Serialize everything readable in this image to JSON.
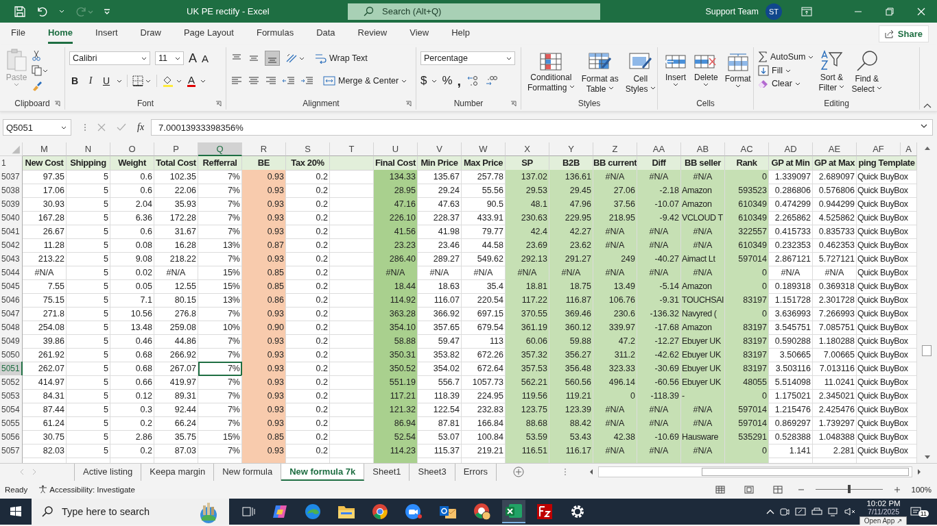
{
  "title_bar": {
    "title": "UK PE rectify  -  Excel",
    "search_placeholder": "Search (Alt+Q)",
    "user": "Support Team",
    "avatar": "ST"
  },
  "menu_tabs": [
    {
      "label": "File",
      "selected": false
    },
    {
      "label": "Home",
      "selected": true
    },
    {
      "label": "Insert",
      "selected": false
    },
    {
      "label": "Draw",
      "selected": false
    },
    {
      "label": "Page Layout",
      "selected": false
    },
    {
      "label": "Formulas",
      "selected": false
    },
    {
      "label": "Data",
      "selected": false
    },
    {
      "label": "Review",
      "selected": false
    },
    {
      "label": "View",
      "selected": false
    },
    {
      "label": "Help",
      "selected": false
    }
  ],
  "share": "Share",
  "ribbon": {
    "clipboard": {
      "paste": "Paste",
      "label": "Clipboard"
    },
    "font": {
      "name": "Calibri",
      "size": "11",
      "grow": "A",
      "shrink": "A",
      "bold": "B",
      "italic": "I",
      "underline": "U",
      "font_color": "A",
      "label": "Font"
    },
    "alignment": {
      "wrap": "Wrap Text",
      "merge": "Merge & Center",
      "label": "Alignment"
    },
    "number": {
      "format": "Percentage",
      "currency": "$",
      "percent": "%",
      "comma": ",",
      "label": "Number"
    },
    "styles": {
      "buttons": [
        [
          "Conditional",
          "Formatting"
        ],
        [
          "Format as",
          "Table"
        ],
        [
          "Cell",
          "Styles"
        ]
      ],
      "label": "Styles"
    },
    "cells": {
      "buttons": [
        "Insert",
        "Delete",
        "Format"
      ],
      "label": "Cells"
    },
    "editing": {
      "autosum": "AutoSum",
      "fill": "Fill",
      "clear": "Clear",
      "sort": [
        "Sort &",
        "Filter"
      ],
      "find": [
        "Find &",
        "Select"
      ],
      "label": "Editing"
    }
  },
  "formula_bar": {
    "name_box": "Q5051",
    "fx": "fx",
    "formula": "7.00013933398356%"
  },
  "sheet": {
    "header_row": "1",
    "columns": [
      {
        "letter": "M",
        "heading": "New Cost",
        "kind": "number",
        "selected": false
      },
      {
        "letter": "N",
        "heading": "Shipping",
        "kind": "number",
        "selected": false
      },
      {
        "letter": "O",
        "heading": "Weight",
        "kind": "number",
        "selected": false
      },
      {
        "letter": "P",
        "heading": "Total Cost",
        "kind": "number",
        "selected": false
      },
      {
        "letter": "Q",
        "heading": "Refferral",
        "kind": "number",
        "selected": true
      },
      {
        "letter": "R",
        "heading": "BE",
        "kind": "number",
        "selected": false,
        "color": "#f8cbad"
      },
      {
        "letter": "S",
        "heading": "Tax 20%",
        "kind": "number",
        "selected": false
      },
      {
        "letter": "T",
        "kind": "blank",
        "selected": false
      },
      {
        "letter": "U",
        "heading": "Final Cost",
        "kind": "number",
        "selected": false,
        "color": "#a9d08e"
      },
      {
        "letter": "V",
        "heading": "Min Price",
        "kind": "number",
        "selected": false
      },
      {
        "letter": "W",
        "heading": "Max Price",
        "kind": "number",
        "selected": false
      },
      {
        "letter": "X",
        "heading": "SP",
        "kind": "number",
        "selected": false,
        "color": "#c6e0b4"
      },
      {
        "letter": "Y",
        "heading": "B2B",
        "kind": "number",
        "selected": false,
        "color": "#c6e0b4"
      },
      {
        "letter": "Z",
        "heading": "BB current",
        "kind": "number",
        "selected": false,
        "color": "#c6e0b4"
      },
      {
        "letter": "AA",
        "heading": "Diff",
        "kind": "number",
        "selected": false,
        "color": "#c6e0b4"
      },
      {
        "letter": "AB",
        "heading": "BB seller",
        "kind": "text",
        "selected": false,
        "color": "#c6e0b4"
      },
      {
        "letter": "AC",
        "heading": "Rank",
        "kind": "number",
        "selected": false,
        "color": "#c6e0b4"
      },
      {
        "letter": "AD",
        "heading": "GP at Min",
        "kind": "number",
        "selected": false
      },
      {
        "letter": "AE",
        "heading": "GP at Max",
        "kind": "number",
        "selected": false
      },
      {
        "letter": "AF",
        "heading": "ping Template",
        "kind": "text",
        "selected": false
      },
      {
        "letter": "A",
        "kind": "cut",
        "selected": false
      }
    ],
    "rows": [
      {
        "number": "5037",
        "selected": false,
        "cells": [
          "97.35",
          "5",
          "0.6",
          "102.35",
          "7%",
          "0.93",
          "0.2",
          "",
          "134.33",
          "135.67",
          "257.78",
          "137.02",
          "136.61",
          "#N/A",
          "#N/A",
          "#N/A",
          "0",
          "1.339097",
          "2.689097",
          "Quick BuyBox"
        ]
      },
      {
        "number": "5038",
        "selected": false,
        "cells": [
          "17.06",
          "5",
          "0.6",
          "22.06",
          "7%",
          "0.93",
          "0.2",
          "",
          "28.95",
          "29.24",
          "55.56",
          "29.53",
          "29.45",
          "27.06",
          "-2.18",
          "Amazon",
          "593523",
          "0.286806",
          "0.576806",
          "Quick BuyBox"
        ]
      },
      {
        "number": "5039",
        "selected": false,
        "cells": [
          "30.93",
          "5",
          "2.04",
          "35.93",
          "7%",
          "0.93",
          "0.2",
          "",
          "47.16",
          "47.63",
          "90.5",
          "48.1",
          "47.96",
          "37.56",
          "-10.07",
          "Amazon",
          "610349",
          "0.474299",
          "0.944299",
          "Quick BuyBox"
        ]
      },
      {
        "number": "5040",
        "selected": false,
        "cells": [
          "167.28",
          "5",
          "6.36",
          "172.28",
          "7%",
          "0.93",
          "0.2",
          "",
          "226.10",
          "228.37",
          "433.91",
          "230.63",
          "229.95",
          "218.95",
          "-9.42",
          "VCLOUD T",
          "610349",
          "2.265862",
          "4.525862",
          "Quick BuyBox"
        ]
      },
      {
        "number": "5041",
        "selected": false,
        "cells": [
          "26.67",
          "5",
          "0.6",
          "31.67",
          "7%",
          "0.93",
          "0.2",
          "",
          "41.56",
          "41.98",
          "79.77",
          "42.4",
          "42.27",
          "#N/A",
          "#N/A",
          "#N/A",
          "322557",
          "0.415733",
          "0.835733",
          "Quick BuyBox"
        ]
      },
      {
        "number": "5042",
        "selected": false,
        "cells": [
          "11.28",
          "5",
          "0.08",
          "16.28",
          "13%",
          "0.87",
          "0.2",
          "",
          "23.23",
          "23.46",
          "44.58",
          "23.69",
          "23.62",
          "#N/A",
          "#N/A",
          "#N/A",
          "610349",
          "0.232353",
          "0.462353",
          "Quick BuyBox"
        ]
      },
      {
        "number": "5043",
        "selected": false,
        "cells": [
          "213.22",
          "5",
          "9.08",
          "218.22",
          "7%",
          "0.93",
          "0.2",
          "",
          "286.40",
          "289.27",
          "549.62",
          "292.13",
          "291.27",
          "249",
          "-40.27",
          "Aimact Lt",
          "597014",
          "2.867121",
          "5.727121",
          "Quick BuyBox"
        ]
      },
      {
        "number": "5044",
        "selected": false,
        "cells": [
          "#N/A",
          "5",
          "0.02",
          "#N/A",
          "15%",
          "0.85",
          "0.2",
          "",
          "#N/A",
          "#N/A",
          "#N/A",
          "#N/A",
          "#N/A",
          "#N/A",
          "#N/A",
          "#N/A",
          "0",
          "#N/A",
          "#N/A",
          "Quick BuyBox"
        ]
      },
      {
        "number": "5045",
        "selected": false,
        "cells": [
          "7.55",
          "5",
          "0.05",
          "12.55",
          "15%",
          "0.85",
          "0.2",
          "",
          "18.44",
          "18.63",
          "35.4",
          "18.81",
          "18.75",
          "13.49",
          "-5.14",
          "Amazon",
          "0",
          "0.189318",
          "0.369318",
          "Quick BuyBox"
        ]
      },
      {
        "number": "5046",
        "selected": false,
        "cells": [
          "75.15",
          "5",
          "7.1",
          "80.15",
          "13%",
          "0.86",
          "0.2",
          "",
          "114.92",
          "116.07",
          "220.54",
          "117.22",
          "116.87",
          "106.76",
          "-9.31",
          "TOUCHSAI",
          "83197",
          "1.151728",
          "2.301728",
          "Quick BuyBox"
        ]
      },
      {
        "number": "5047",
        "selected": false,
        "cells": [
          "271.8",
          "5",
          "10.56",
          "276.8",
          "7%",
          "0.93",
          "0.2",
          "",
          "363.28",
          "366.92",
          "697.15",
          "370.55",
          "369.46",
          "230.6",
          "-136.32",
          "Navyred (",
          "0",
          "3.636993",
          "7.266993",
          "Quick BuyBox"
        ]
      },
      {
        "number": "5048",
        "selected": false,
        "cells": [
          "254.08",
          "5",
          "13.48",
          "259.08",
          "10%",
          "0.90",
          "0.2",
          "",
          "354.10",
          "357.65",
          "679.54",
          "361.19",
          "360.12",
          "339.97",
          "-17.68",
          "Amazon",
          "83197",
          "3.545751",
          "7.085751",
          "Quick BuyBox"
        ]
      },
      {
        "number": "5049",
        "selected": false,
        "cells": [
          "39.86",
          "5",
          "0.46",
          "44.86",
          "7%",
          "0.93",
          "0.2",
          "",
          "58.88",
          "59.47",
          "113",
          "60.06",
          "59.88",
          "47.2",
          "-12.27",
          "Ebuyer UK",
          "83197",
          "0.590288",
          "1.180288",
          "Quick BuyBox"
        ]
      },
      {
        "number": "5050",
        "selected": false,
        "cells": [
          "261.92",
          "5",
          "0.68",
          "266.92",
          "7%",
          "0.93",
          "0.2",
          "",
          "350.31",
          "353.82",
          "672.26",
          "357.32",
          "356.27",
          "311.2",
          "-42.62",
          "Ebuyer UK",
          "83197",
          "3.50665",
          "7.00665",
          "Quick BuyBox"
        ]
      },
      {
        "number": "5051",
        "selected": true,
        "cells": [
          "262.07",
          "5",
          "0.68",
          "267.07",
          "7%",
          "0.93",
          "0.2",
          "",
          "350.52",
          "354.02",
          "672.64",
          "357.53",
          "356.48",
          "323.33",
          "-30.69",
          "Ebuyer UK",
          "83197",
          "3.503116",
          "7.013116",
          "Quick BuyBox"
        ]
      },
      {
        "number": "5052",
        "selected": false,
        "cells": [
          "414.97",
          "5",
          "0.66",
          "419.97",
          "7%",
          "0.93",
          "0.2",
          "",
          "551.19",
          "556.7",
          "1057.73",
          "562.21",
          "560.56",
          "496.14",
          "-60.56",
          "Ebuyer UK",
          "48055",
          "5.514098",
          "11.0241",
          "Quick BuyBox"
        ]
      },
      {
        "number": "5053",
        "selected": false,
        "cells": [
          "84.31",
          "5",
          "0.12",
          "89.31",
          "7%",
          "0.93",
          "0.2",
          "",
          "117.21",
          "118.39",
          "224.95",
          "119.56",
          "119.21",
          "0",
          "-118.39",
          "-",
          "0",
          "1.175021",
          "2.345021",
          "Quick BuyBox"
        ]
      },
      {
        "number": "5054",
        "selected": false,
        "cells": [
          "87.44",
          "5",
          "0.3",
          "92.44",
          "7%",
          "0.93",
          "0.2",
          "",
          "121.32",
          "122.54",
          "232.83",
          "123.75",
          "123.39",
          "#N/A",
          "#N/A",
          "#N/A",
          "597014",
          "1.215476",
          "2.425476",
          "Quick BuyBox"
        ]
      },
      {
        "number": "5055",
        "selected": false,
        "cells": [
          "61.24",
          "5",
          "0.2",
          "66.24",
          "7%",
          "0.93",
          "0.2",
          "",
          "86.94",
          "87.81",
          "166.84",
          "88.68",
          "88.42",
          "#N/A",
          "#N/A",
          "#N/A",
          "597014",
          "0.869297",
          "1.739297",
          "Quick BuyBox"
        ]
      },
      {
        "number": "5056",
        "selected": false,
        "cells": [
          "30.75",
          "5",
          "2.86",
          "35.75",
          "15%",
          "0.85",
          "0.2",
          "",
          "52.54",
          "53.07",
          "100.84",
          "53.59",
          "53.43",
          "42.38",
          "-10.69",
          "Hausware",
          "535291",
          "0.528388",
          "1.048388",
          "Quick BuyBox"
        ]
      },
      {
        "number": "5057",
        "selected": false,
        "cells": [
          "82.03",
          "5",
          "0.2",
          "87.03",
          "7%",
          "0.93",
          "0.2",
          "",
          "114.23",
          "115.37",
          "219.21",
          "116.51",
          "116.17",
          "#N/A",
          "#N/A",
          "#N/A",
          "0",
          "1.141",
          "2.281",
          "Quick BuyBox"
        ]
      }
    ]
  },
  "sheet_tabs": [
    {
      "label": "Active listing",
      "selected": false
    },
    {
      "label": "Keepa margin",
      "selected": false
    },
    {
      "label": "New formula",
      "selected": false
    },
    {
      "label": "New formula 7k",
      "selected": true
    },
    {
      "label": "Sheet1",
      "selected": false
    },
    {
      "label": "Sheet3",
      "selected": false
    },
    {
      "label": "Errors",
      "selected": false
    }
  ],
  "status_bar": {
    "ready": "Ready",
    "accessibility": "Accessibility: Investigate",
    "zoom": "100%",
    "zoom_slider": {
      "level": 0.5
    }
  },
  "taskbar": {
    "search_placeholder": "Type here to search",
    "time": "10:02 PM",
    "date": "7/11/2025",
    "tooltip": "Open App ↗",
    "notifications": "11"
  }
}
